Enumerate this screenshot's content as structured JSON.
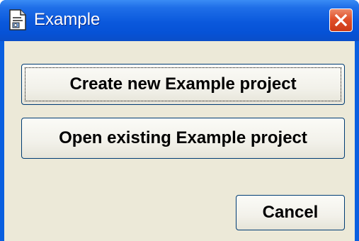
{
  "window": {
    "title": "Example",
    "app_icon": "document-icon",
    "close_icon": "close-icon"
  },
  "buttons": {
    "create_label": "Create new Example project",
    "open_label": "Open existing Example project",
    "cancel_label": "Cancel"
  },
  "colors": {
    "titlebar": "#0a58dc",
    "dialog_background": "#ece9d8",
    "close_button": "#e0502a",
    "button_border": "#003c74"
  }
}
